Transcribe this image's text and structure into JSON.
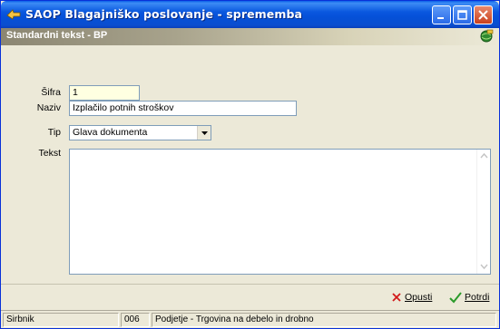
{
  "window": {
    "title": "SAOP Blagajniško poslovanje - sprememba",
    "header": "Standardni tekst - BP"
  },
  "form": {
    "sifra_label": "Šifra",
    "sifra_value": "1",
    "naziv_label": "Naziv",
    "naziv_value": "Izplačilo potnih stroškov",
    "tip_label": "Tip",
    "tip_value": "Glava dokumenta",
    "tekst_label": "Tekst",
    "tekst_value": ""
  },
  "buttons": {
    "cancel_label": "Opusti",
    "confirm_label": "Potrdi"
  },
  "status": {
    "user": "Sirbnik",
    "code": "006",
    "company": "Podjetje - Trgovina na debelo in drobno"
  }
}
